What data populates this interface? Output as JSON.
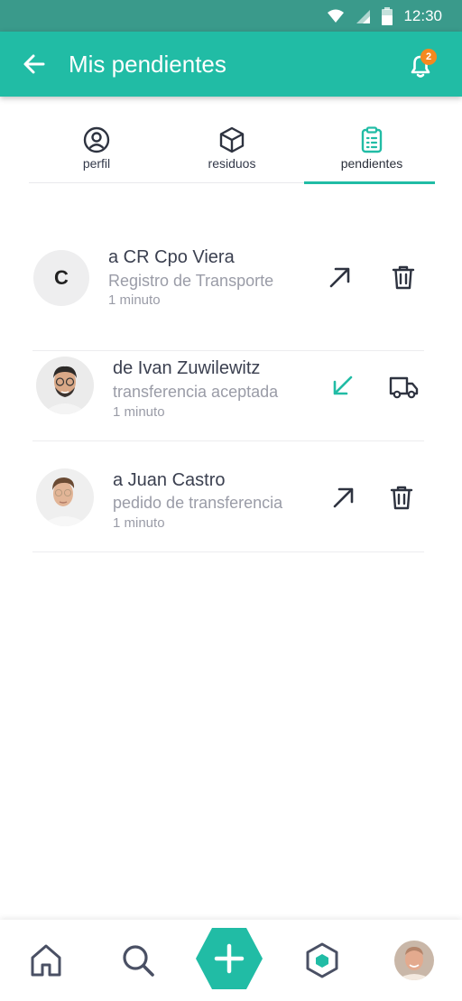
{
  "status_bar": {
    "time": "12:30"
  },
  "header": {
    "title": "Mis pendientes",
    "notification_count": "2"
  },
  "tabs": [
    {
      "label": "perfil",
      "icon": "user-circle-icon"
    },
    {
      "label": "residuos",
      "icon": "box-icon"
    },
    {
      "label": "pendientes",
      "icon": "clipboard-list-icon",
      "active": true
    }
  ],
  "pending": [
    {
      "avatar_letter": "C",
      "title": "a CR Cpo Viera",
      "subtitle": "Registro de Transporte",
      "time": "1 minuto",
      "direction_icon": "arrow-up-right-icon",
      "action_icon": "trash-icon"
    },
    {
      "avatar_letter": "",
      "title": "de Ivan Zuwilewitz",
      "subtitle": "transferencia aceptada",
      "time": "1 minuto",
      "direction_icon": "arrow-down-left-icon",
      "action_icon": "truck-icon"
    },
    {
      "avatar_letter": "",
      "title": "a Juan Castro",
      "subtitle": "pedido de transferencia",
      "time": "1 minuto",
      "direction_icon": "arrow-up-right-icon",
      "action_icon": "trash-icon"
    }
  ],
  "colors": {
    "primary": "#21bca5",
    "status_bar": "#3a9a8b",
    "badge": "#f5891f",
    "text": "#3b4050",
    "muted": "#9a9ca7"
  },
  "bottom_nav": [
    "home-icon",
    "search-icon",
    "add-hexagon-button",
    "sync-icon",
    "profile-avatar"
  ]
}
